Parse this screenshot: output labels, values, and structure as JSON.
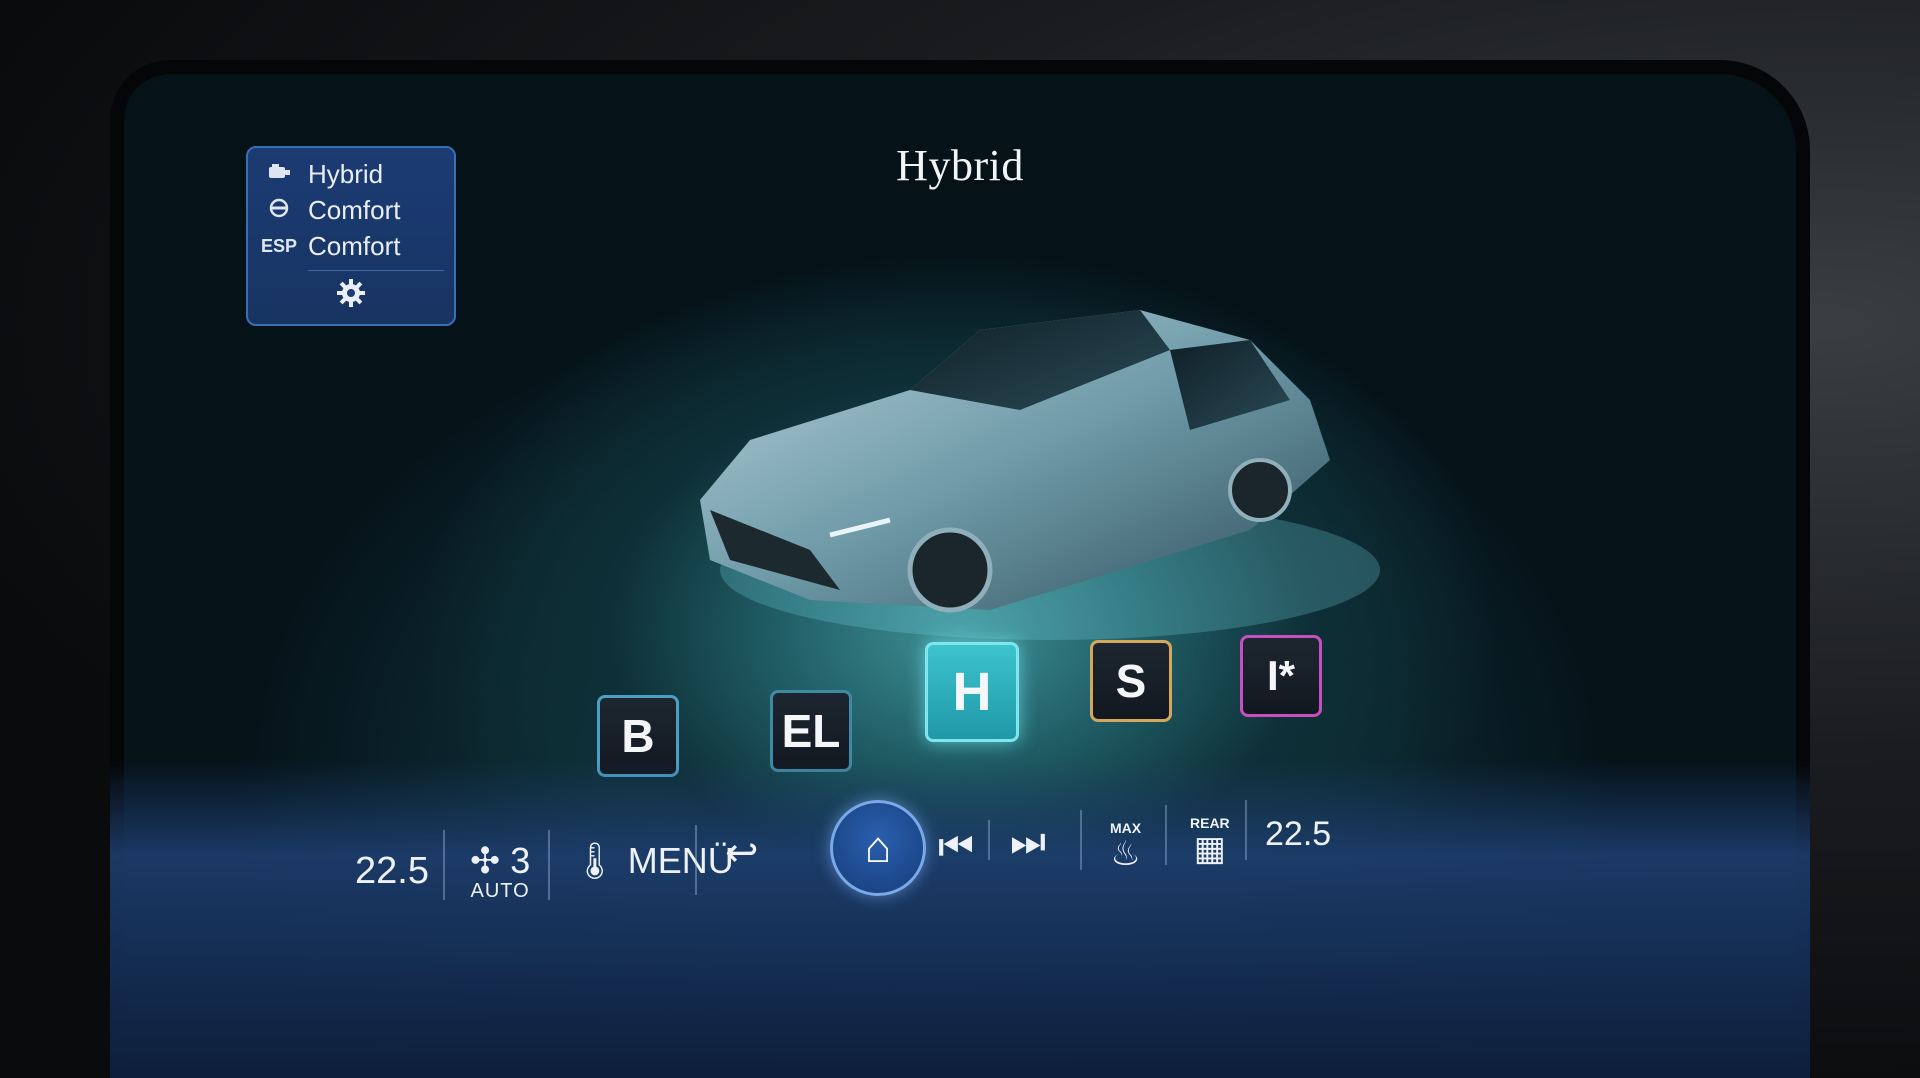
{
  "screen": {
    "title": "Hybrid"
  },
  "status_panel": {
    "rows": [
      {
        "icon": "engine-icon",
        "label": "Hybrid"
      },
      {
        "icon": "steering-wheel-icon",
        "label": "Comfort"
      },
      {
        "icon": "esp-icon",
        "icon_text": "ESP",
        "label": "Comfort"
      }
    ],
    "settings_icon": "gear-icon"
  },
  "drive_modes": [
    {
      "key": "B",
      "label": "B",
      "accent": "#4b9fc4"
    },
    {
      "key": "EL",
      "label": "EL",
      "accent": "#3f8aa3"
    },
    {
      "key": "H",
      "label": "H",
      "accent": "#7fe6ee",
      "selected": true
    },
    {
      "key": "S",
      "label": "S",
      "accent": "#d5a75b"
    },
    {
      "key": "I",
      "label": "I*",
      "accent": "#c74fbf"
    }
  ],
  "dock": {
    "left_temp": "22.5",
    "fan_level": "3",
    "fan_mode": "AUTO",
    "menu_label": "MENÜ",
    "defrost_label": "MAX",
    "rear_label": "REAR",
    "right_temp": "22.5"
  }
}
